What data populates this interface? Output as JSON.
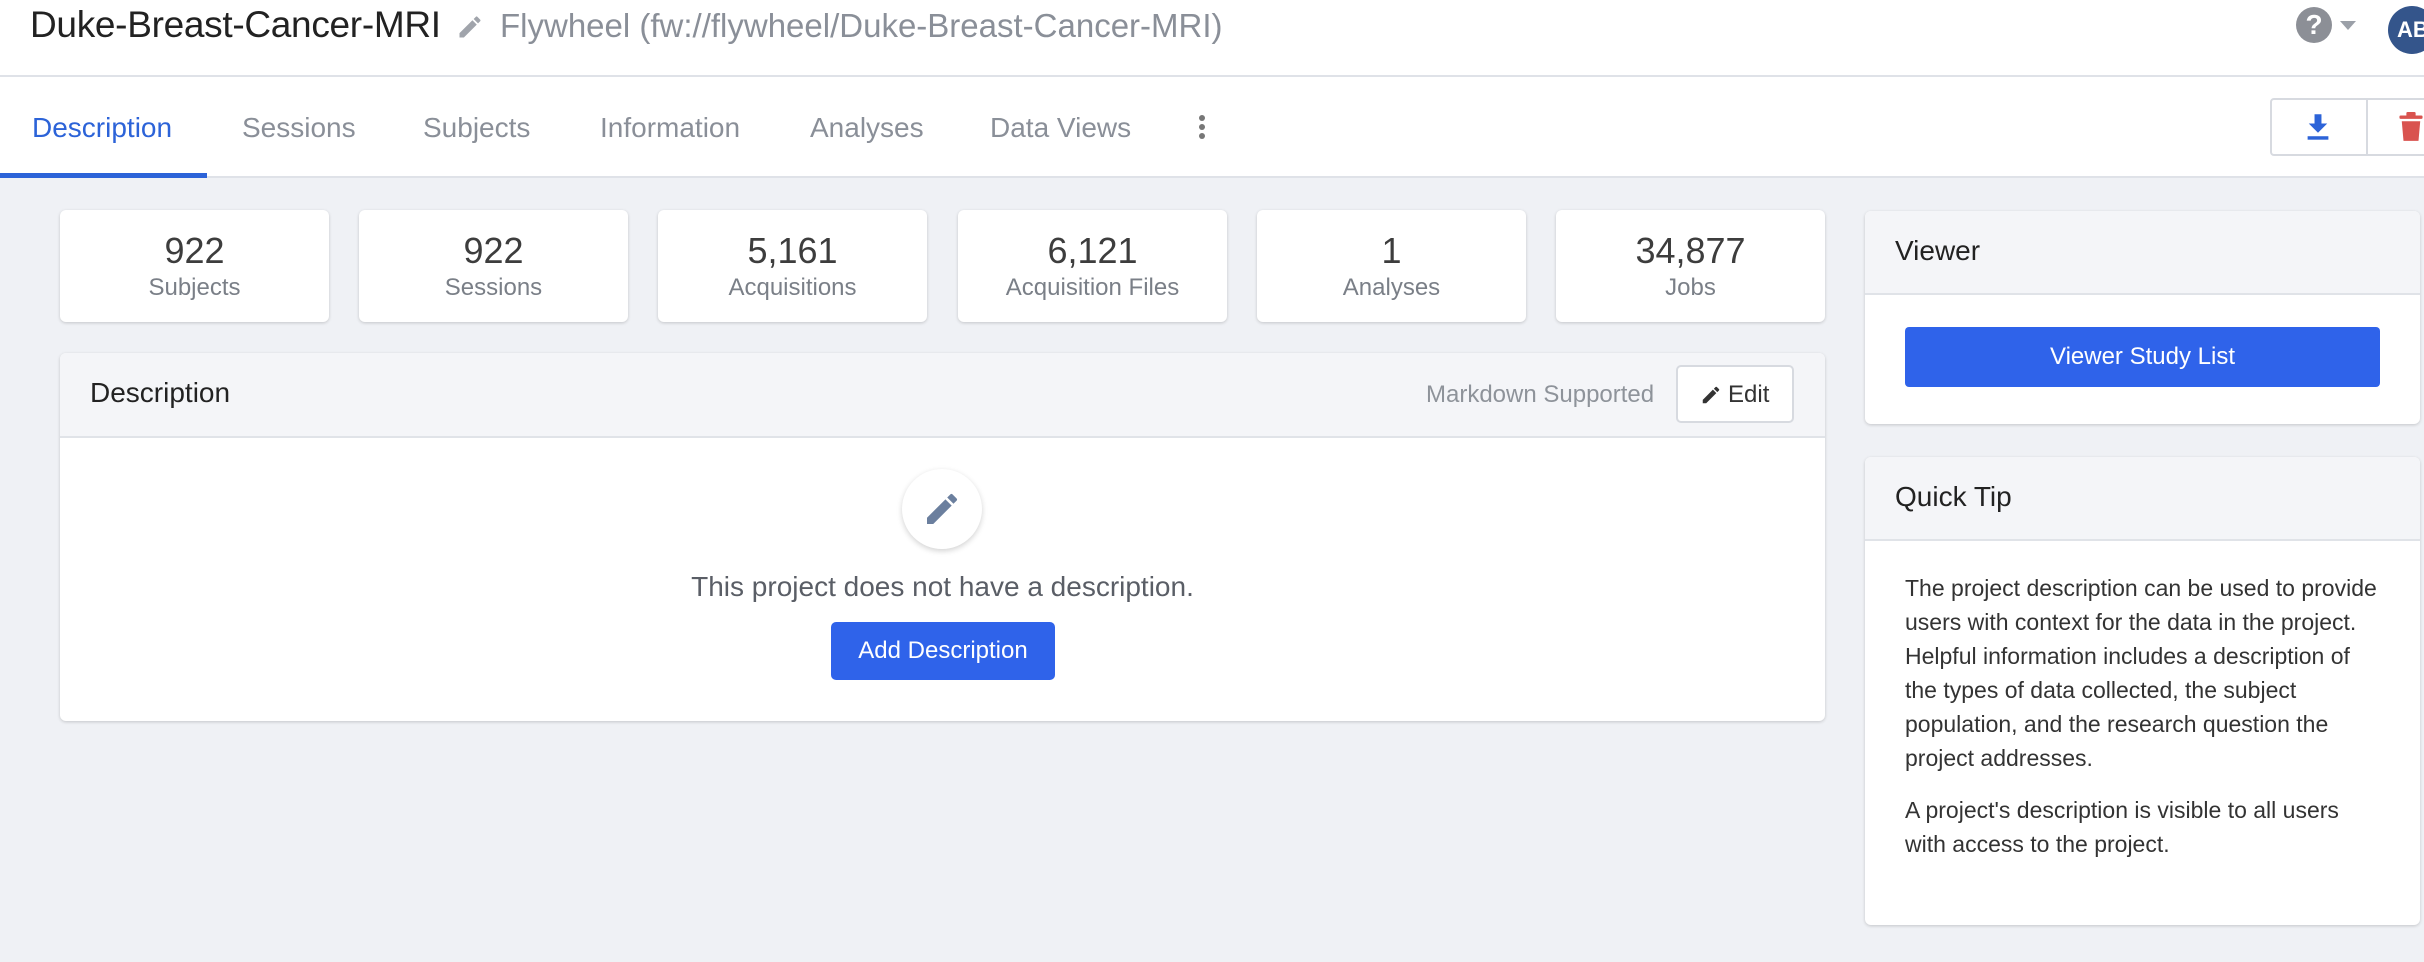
{
  "header": {
    "title": "Duke-Breast-Cancer-MRI",
    "path": "Flywheel (fw://flywheel/Duke-Breast-Cancer-MRI)",
    "help_glyph": "?",
    "avatar_initials": "AB"
  },
  "tabs": [
    {
      "label": "Description",
      "active": true
    },
    {
      "label": "Sessions"
    },
    {
      "label": "Subjects"
    },
    {
      "label": "Information"
    },
    {
      "label": "Analyses"
    },
    {
      "label": "Data Views"
    }
  ],
  "stats": [
    {
      "value": "922",
      "label": "Subjects"
    },
    {
      "value": "922",
      "label": "Sessions"
    },
    {
      "value": "5,161",
      "label": "Acquisitions"
    },
    {
      "value": "6,121",
      "label": "Acquisition Files"
    },
    {
      "value": "1",
      "label": "Analyses"
    },
    {
      "value": "34,877",
      "label": "Jobs"
    }
  ],
  "description_panel": {
    "title": "Description",
    "markdown_note": "Markdown Supported",
    "edit_label": "Edit",
    "empty_text": "This project does not have a description.",
    "add_label": "Add Description"
  },
  "viewer": {
    "title": "Viewer",
    "button_label": "Viewer Study List"
  },
  "quick_tip": {
    "title": "Quick Tip",
    "paragraph_1": "The project description can be used to provide users with context for the data in the project. Helpful information includes a description of the types of data collected, the subject population, and the research question the project addresses.",
    "paragraph_2": "A project's description is visible to all users with access to the project."
  },
  "colors": {
    "accent": "#2c63d8",
    "primary_button": "#2f63ea",
    "danger": "#d9534f",
    "avatar": "#34558b"
  }
}
